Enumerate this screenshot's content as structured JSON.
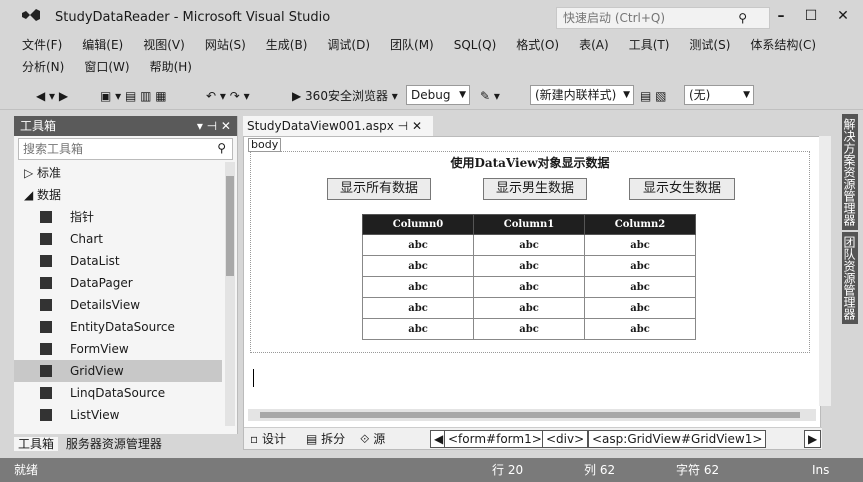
{
  "window": {
    "title": "StudyDataReader - Microsoft Visual Studio",
    "quick_launch_placeholder": "快速启动 (Ctrl+Q)"
  },
  "menu": {
    "row1": [
      "文件(F)",
      "编辑(E)",
      "视图(V)",
      "网站(S)",
      "生成(B)",
      "调试(D)",
      "团队(M)",
      "SQL(Q)",
      "格式(O)",
      "表(A)",
      "工具(T)",
      "测试(S)",
      "体系结构(C)"
    ],
    "row2": [
      "分析(N)",
      "窗口(W)",
      "帮助(H)"
    ]
  },
  "toolbar": {
    "browser": "360安全浏览器",
    "config": "Debug",
    "style": "(新建内联样式)",
    "none": "(无)"
  },
  "toolbox": {
    "title": "工具箱",
    "search_placeholder": "搜索工具箱",
    "groups": [
      "▷ 标准",
      "◢ 数据"
    ],
    "items": [
      "指针",
      "Chart",
      "DataList",
      "DataPager",
      "DetailsView",
      "EntityDataSource",
      "FormView",
      "GridView",
      "LinqDataSource",
      "ListView"
    ],
    "tabs": [
      "工具箱",
      "服务器资源管理器"
    ]
  },
  "editor": {
    "tab_label": "StudyDataView001.aspx",
    "body_tag": "body",
    "heading": "使用DataView对象显示数据",
    "buttons": [
      "显示所有数据",
      "显示男生数据",
      "显示女生数据"
    ],
    "grid": {
      "columns": [
        "Column0",
        "Column1",
        "Column2"
      ],
      "rows": [
        [
          "abc",
          "abc",
          "abc"
        ],
        [
          "abc",
          "abc",
          "abc"
        ],
        [
          "abc",
          "abc",
          "abc"
        ],
        [
          "abc",
          "abc",
          "abc"
        ],
        [
          "abc",
          "abc",
          "abc"
        ]
      ]
    },
    "views": [
      "设计",
      "拆分",
      "源"
    ],
    "breadcrumbs": [
      "<form#form1>",
      "<div>",
      "<asp:GridView#GridView1>"
    ]
  },
  "side_tabs": [
    "解决方案资源管理器",
    "团队资源管理器"
  ],
  "status": {
    "ready": "就绪",
    "line": "行 20",
    "col": "列 62",
    "char": "字符 62",
    "mode": "Ins"
  }
}
